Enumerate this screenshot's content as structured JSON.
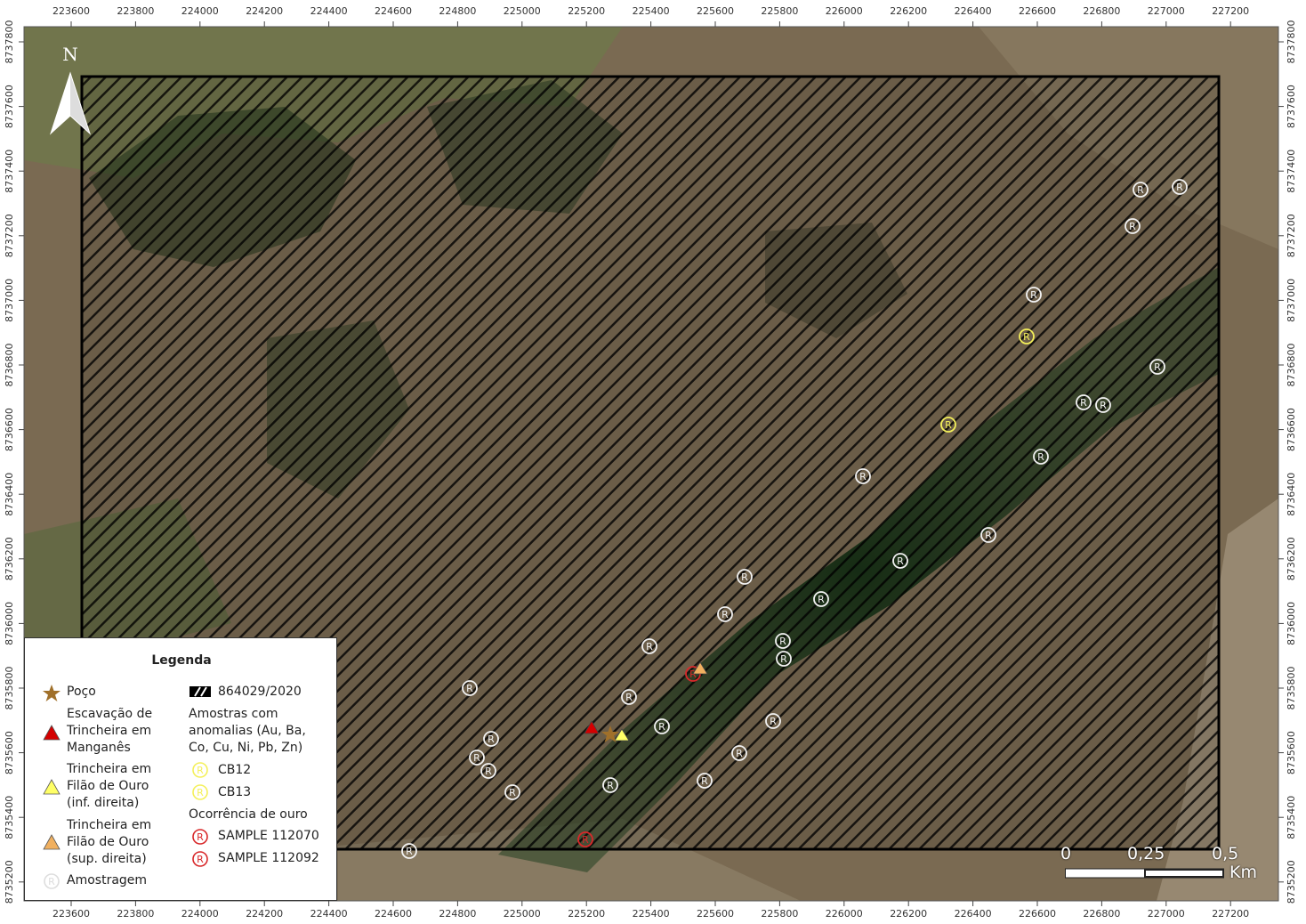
{
  "map": {
    "x_ticks": [
      "223600",
      "223800",
      "224000",
      "224200",
      "224400",
      "224600",
      "224800",
      "225000",
      "225200",
      "225400",
      "225600",
      "225800",
      "226000",
      "226200",
      "226400",
      "226600",
      "226800",
      "227000",
      "227200"
    ],
    "y_ticks": [
      "8737800",
      "8737600",
      "8737400",
      "8737200",
      "8737000",
      "8736800",
      "8736600",
      "8736400",
      "8736200",
      "8736000",
      "8735800",
      "8735600",
      "8735400",
      "8735200"
    ],
    "north_label": "N",
    "colors": {
      "terrain": "#6b5a45",
      "vegetation": "#1f3a1f",
      "hatch": "#000000",
      "sample_white": "#f2f2f2",
      "anomaly_yellow": "#f4f05a",
      "gold_red": "#d8282a",
      "well_brown": "#a0702a",
      "trench_red": "#d40000",
      "trench_yellow": "#ffff66",
      "trench_orange": "#f0b060"
    }
  },
  "legend": {
    "title": "Legenda",
    "items": {
      "poco": "Poço",
      "escavacao_1": "Escavação de",
      "escavacao_2": "Trincheira em",
      "escavacao_3": "Manganês",
      "inf_1": "Trincheira em",
      "inf_2": "Filão de Ouro",
      "inf_3": "(inf. direita)",
      "sup_1": "Trincheira em",
      "sup_2": "Filão de Ouro",
      "sup_3": "(sup. direita)",
      "amostragem": "Amostragem",
      "processo": "864029/2020",
      "anom_1": "Amostras com",
      "anom_2": "anomalias (Au, Ba,",
      "anom_3": "Co, Cu, Ni, Pb, Zn)",
      "cb12": "CB12",
      "cb13": "CB13",
      "ouro": "Ocorrência de ouro",
      "s1": "SAMPLE 112070",
      "s2": "SAMPLE 112092"
    }
  },
  "scalebar": {
    "labels": [
      "0",
      "0,25",
      "0,5"
    ],
    "unit": "Km"
  }
}
